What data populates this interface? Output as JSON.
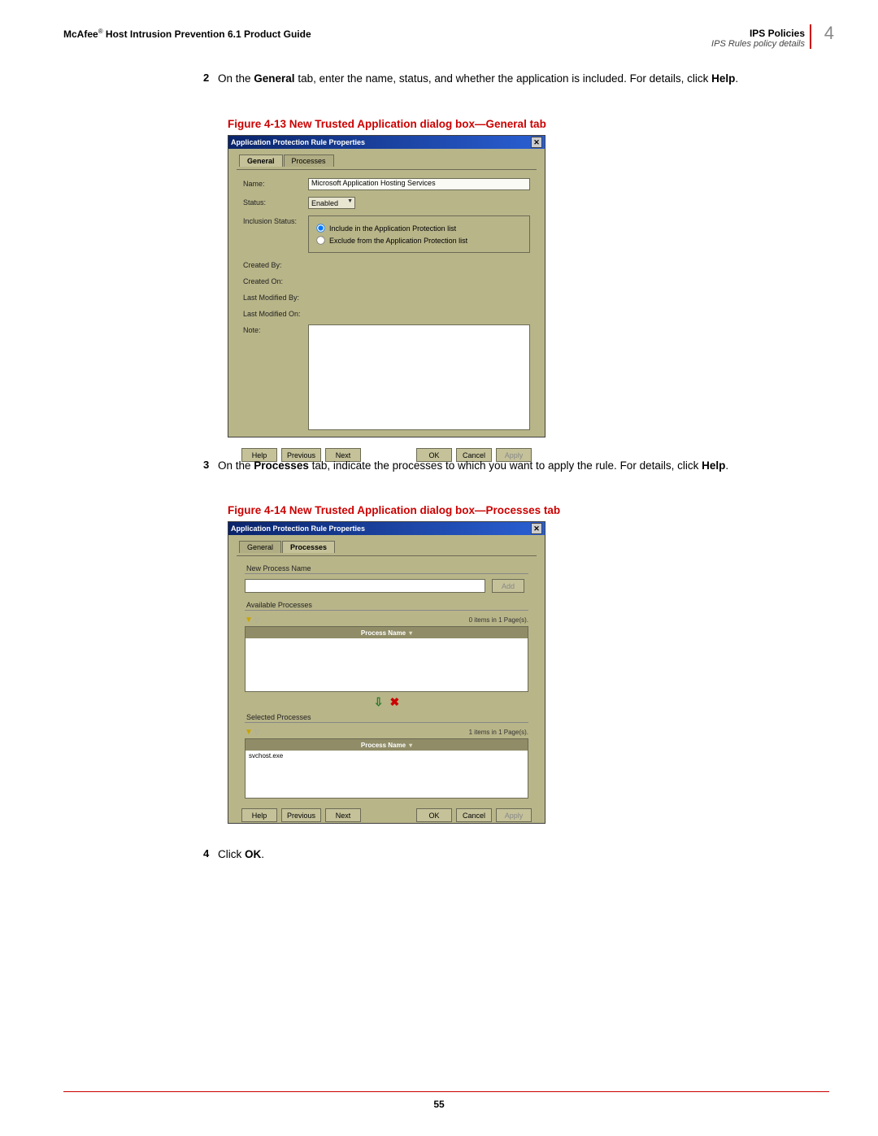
{
  "header": {
    "product_prefix": "McAfee",
    "product_reg": "®",
    "product": " Host Intrusion Prevention 6.1 Product Guide",
    "section": "IPS Policies",
    "subsection": "IPS Rules policy details",
    "chapter_num": "4"
  },
  "steps": {
    "s2_num": "2",
    "s2_a": "On the ",
    "s2_b": "General",
    "s2_c": " tab, enter the name, status, and whether the application is included. For details, click ",
    "s2_d": "Help",
    "s2_e": ".",
    "s3_num": "3",
    "s3_a": "On the ",
    "s3_b": "Processes",
    "s3_c": " tab, indicate the processes to which you want to apply the rule. For details, click ",
    "s3_d": "Help",
    "s3_e": ".",
    "s4_num": "4",
    "s4_a": "Click ",
    "s4_b": "OK",
    "s4_c": "."
  },
  "captions": {
    "f13": "Figure 4-13  New Trusted Application dialog box—General tab",
    "f14": "Figure 4-14  New Trusted Application dialog box—Processes tab"
  },
  "dialog_general": {
    "title": "Application Protection Rule Properties",
    "tab_general": "General",
    "tab_processes": "Processes",
    "lbl_name": "Name:",
    "val_name": "Microsoft Application Hosting Services",
    "lbl_status": "Status:",
    "val_status": "Enabled",
    "lbl_inclusion": "Inclusion Status:",
    "radio_include": "Include in the Application Protection list",
    "radio_exclude": "Exclude from the Application Protection list",
    "lbl_created_by": "Created By:",
    "lbl_created_on": "Created On:",
    "lbl_mod_by": "Last Modified By:",
    "lbl_mod_on": "Last Modified On:",
    "lbl_note": "Note:",
    "btn_help": "Help",
    "btn_prev": "Previous",
    "btn_next": "Next",
    "btn_ok": "OK",
    "btn_cancel": "Cancel",
    "btn_apply": "Apply"
  },
  "dialog_proc": {
    "title": "Application Protection Rule Properties",
    "tab_general": "General",
    "tab_processes": "Processes",
    "grp_new": "New Process Name",
    "btn_add": "Add",
    "grp_avail": "Available Processes",
    "pager_avail": "0 items in 1 Page(s).",
    "col_header": "Process Name",
    "grp_sel": "Selected Processes",
    "pager_sel": "1 items in 1 Page(s).",
    "sel_row": "svchost.exe",
    "btn_help": "Help",
    "btn_prev": "Previous",
    "btn_next": "Next",
    "btn_ok": "OK",
    "btn_cancel": "Cancel",
    "btn_apply": "Apply"
  },
  "footer": {
    "page": "55"
  }
}
